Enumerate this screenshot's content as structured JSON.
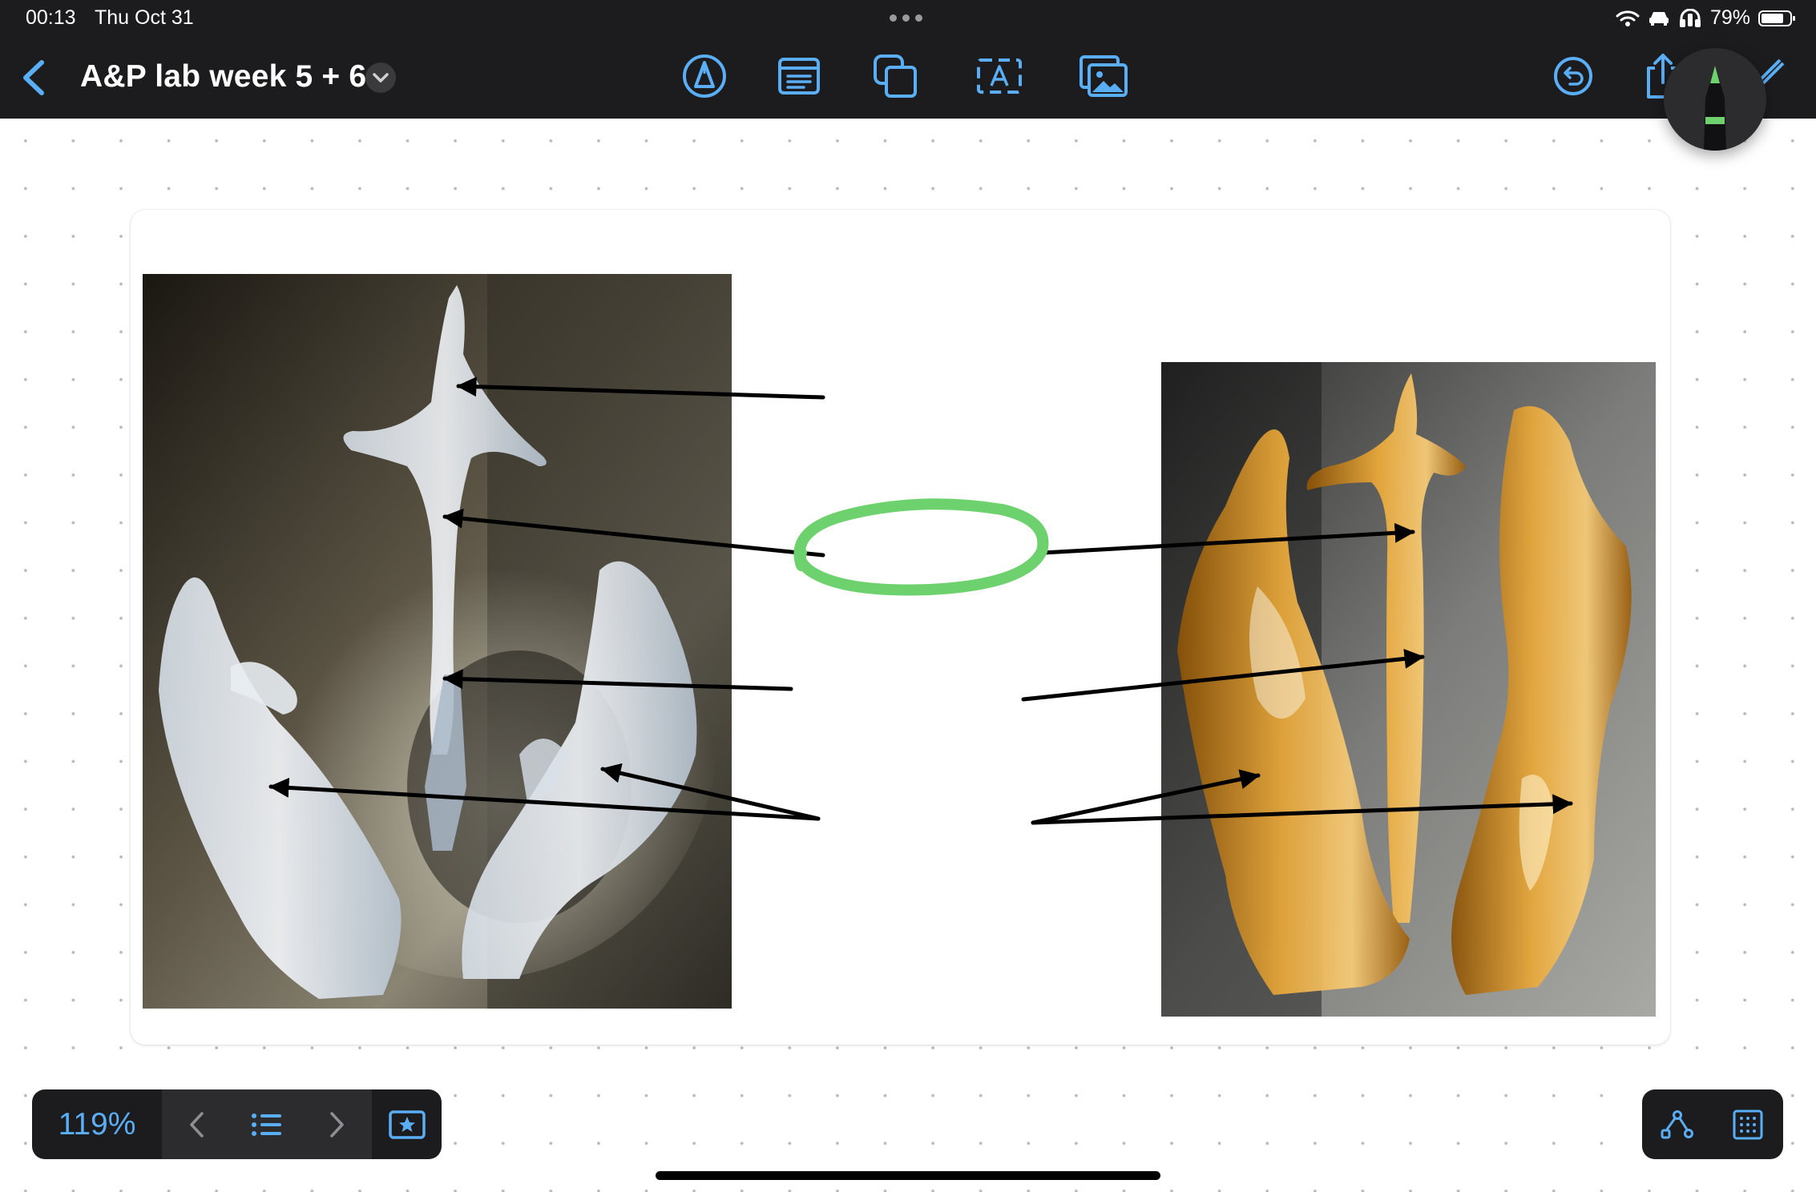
{
  "status_bar": {
    "time": "00:13",
    "date": "Thu Oct 31",
    "battery_percent": "79%",
    "battery_level": 0.79,
    "icons": [
      "wifi-icon",
      "car-icon",
      "headphones-icon",
      "battery-icon"
    ]
  },
  "toolbar": {
    "back_icon": "chevron-left-icon",
    "title": "A&P lab week 5 + 6",
    "title_menu_icon": "chevron-down-icon",
    "tools": [
      "pen-tool-icon",
      "sticky-note-icon",
      "shapes-icon",
      "text-box-icon",
      "insert-image-icon"
    ],
    "right_tools": [
      "undo-icon",
      "share-icon",
      "edit-icon"
    ],
    "accent_color": "#5aaef5"
  },
  "pencil": {
    "icon": "pencil-icon",
    "ink_color": "#6dd16d"
  },
  "canvas": {
    "images": [
      "larynx-model-clear-photo",
      "larynx-model-amber-photo"
    ],
    "highlight_color": "#6dd16d",
    "arrow_color": "#000000"
  },
  "bottom_bar": {
    "zoom": "119%",
    "prev_icon": "chevron-left-icon",
    "list_icon": "list-icon",
    "next_icon": "chevron-right-icon",
    "favorite_icon": "star-icon",
    "lasso_icon": "connector-icon",
    "grid_icon": "grid-icon"
  }
}
